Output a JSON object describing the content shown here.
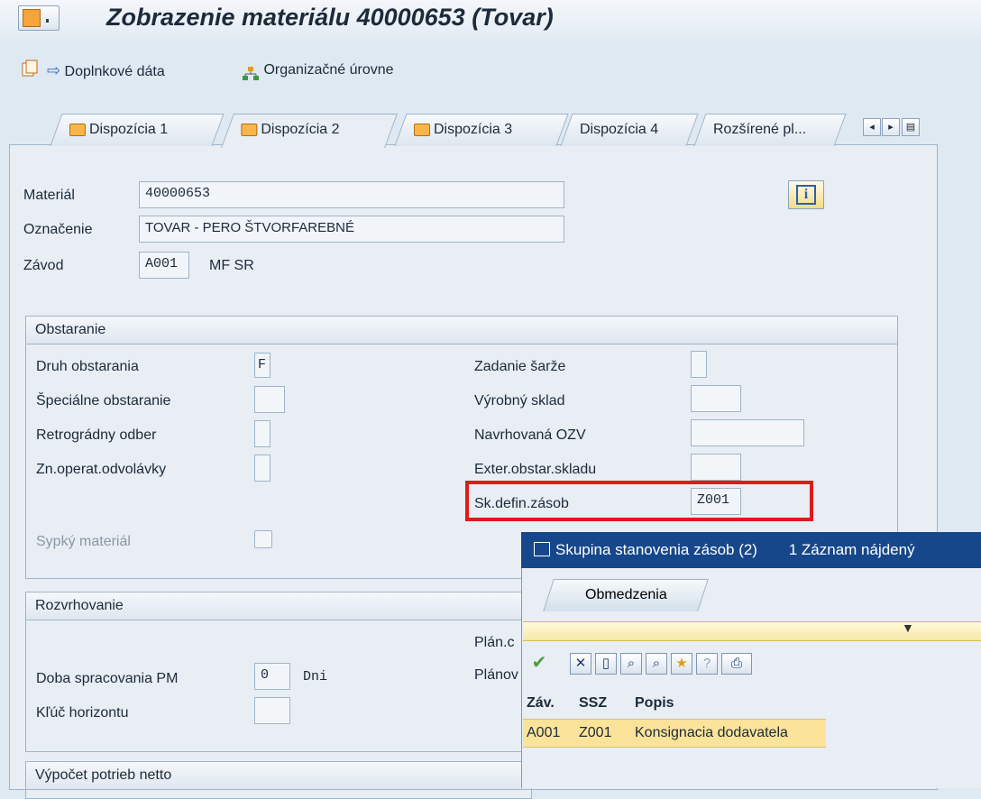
{
  "window": {
    "title": "Zobrazenie materiálu 40000653 (Tovar)"
  },
  "toolbar": {
    "additional_data_label": "Doplnkové dáta",
    "org_levels_label": "Organizačné úrovne"
  },
  "tabs": [
    {
      "label": "Dispozícia 1",
      "active": false
    },
    {
      "label": "Dispozícia 2",
      "active": true
    },
    {
      "label": "Dispozícia 3",
      "active": false
    },
    {
      "label": "Dispozícia 4",
      "active": false
    },
    {
      "label": "Rozšírené pl...",
      "active": false
    }
  ],
  "header": {
    "material_label": "Materiál",
    "material_value": "40000653",
    "description_label": "Označenie",
    "description_value": "TOVAR - PERO ŠTVORFAREBNÉ",
    "plant_label": "Závod",
    "plant_value": "A001",
    "plant_name": "MF SR"
  },
  "procurement": {
    "title": "Obstaranie",
    "procurement_type_label": "Druh obstarania",
    "procurement_type_value": "F",
    "special_procurement_label": "Špeciálne obstaranie",
    "backflush_label": "Retrográdny odber",
    "jit_label": "Zn.operat.odvolávky",
    "bulk_material_label": "Sypký materiál",
    "batch_entry_label": "Zadanie šarže",
    "prod_storage_label": "Výrobný sklad",
    "proposed_supply_area_label": "Navrhovaná OZV",
    "ext_storage_label": "Exter.obstar.skladu",
    "stock_det_group_label": "Sk.defin.zásob",
    "stock_det_group_value": "Z001"
  },
  "scheduling": {
    "title": "Rozvrhovanie",
    "gr_processing_label": "Doba spracovania PM",
    "gr_processing_value": "0",
    "gr_processing_unit": "Dni",
    "horizon_key_label": "Kľúč horizontu",
    "planned_partial_1": "Plán.c",
    "planned_partial_2": "Plánov"
  },
  "net_req": {
    "title": "Výpočet potrieb netto"
  },
  "popup": {
    "title": "Skupina stanovenia zásob (2)",
    "count_text": "1 Záznam nájdený",
    "tab_label": "Obmedzenia",
    "columns": [
      "Záv.",
      "SSZ",
      "Popis"
    ],
    "rows": [
      {
        "plant": "A001",
        "ssz": "Z001",
        "desc": "Konsignacia dodavatela"
      }
    ]
  },
  "colors": {
    "title_bar_popup": "#16478a",
    "highlight_row": "#fbe399",
    "red_highlight": "#e01a1a"
  }
}
